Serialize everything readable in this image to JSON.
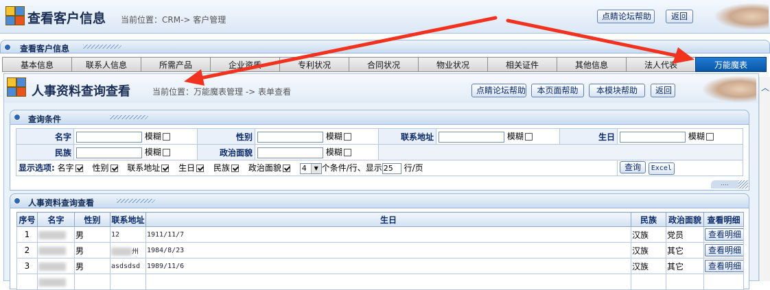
{
  "header": {
    "title": "查看客户信息",
    "location": "当前位置：CRM-> 客户管理",
    "buttons": [
      "点睛论坛帮助",
      "返回"
    ]
  },
  "section": {
    "label": "查看客户信息"
  },
  "tabs": [
    "基本信息",
    "联系人信息",
    "所需产品",
    "企业资质",
    "专利状况",
    "合同状况",
    "物业状况",
    "相关证件",
    "其他信息",
    "法人代表",
    "万能魔表"
  ],
  "active_tab": "万能魔表",
  "inner": {
    "title": "人事资料查询查看",
    "location": "当前位置：万能魔表管理 -> 表单查看",
    "buttons": [
      "点睛论坛帮助",
      "本页面帮助",
      "本模块帮助",
      "返回"
    ]
  },
  "query": {
    "panel_title": "查询条件",
    "fields_row1": [
      {
        "label": "名字",
        "fuzzy": "模糊"
      },
      {
        "label": "性别",
        "fuzzy": "模糊"
      },
      {
        "label": "联系地址",
        "fuzzy": "模糊"
      },
      {
        "label": "生日",
        "fuzzy": "模糊"
      }
    ],
    "fields_row2": [
      {
        "label": "民族",
        "fuzzy": "模糊"
      },
      {
        "label": "政治面貌",
        "fuzzy": "模糊"
      }
    ],
    "display_label": "显示选项:",
    "display_options": [
      "名字",
      "性别",
      "联系地址",
      "生日",
      "民族",
      "政治面貌"
    ],
    "per_row_value": "4",
    "per_row_suffix": "个条件/行、显示",
    "page_size": "25",
    "page_suffix": "行/页",
    "query_button": "查询",
    "excel_button": "Excel",
    "collapse_dots": "...."
  },
  "results": {
    "panel_title": "人事资料查询查看",
    "columns": [
      "序号",
      "名字",
      "性别",
      "联系地址",
      "生日",
      "民族",
      "政治面貌",
      "查看明细"
    ],
    "rows": [
      {
        "no": "1",
        "gender": "男",
        "address": "12",
        "birthday": "1911/11/7",
        "ethnic": "汉族",
        "political": "党员",
        "detail": "查看明细"
      },
      {
        "no": "2",
        "gender": "男",
        "address": "州",
        "birthday": "1984/8/23",
        "ethnic": "汉族",
        "political": "其它",
        "detail": "查看明细"
      },
      {
        "no": "3",
        "gender": "男",
        "address": "asdsdsd",
        "birthday": "1989/11/6",
        "ethnic": "汉族",
        "political": "其它",
        "detail": "查看明细"
      }
    ]
  },
  "colors": {
    "active_tab": "#0a66c2",
    "arrow": "#f0321e",
    "label_text": "#0a2a6a"
  }
}
